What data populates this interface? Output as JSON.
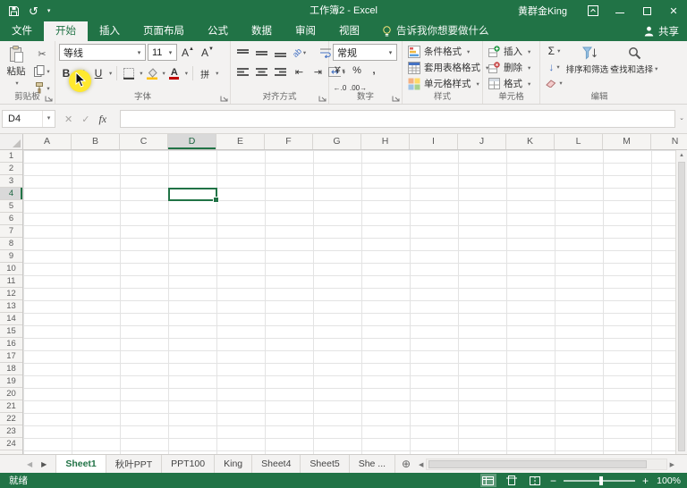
{
  "titlebar": {
    "title": "工作簿2 - Excel",
    "user": "黄群金King"
  },
  "ribbon_tabs": {
    "file": "文件",
    "items": [
      {
        "label": "开始",
        "active": true
      },
      {
        "label": "插入",
        "active": false
      },
      {
        "label": "页面布局",
        "active": false
      },
      {
        "label": "公式",
        "active": false
      },
      {
        "label": "数据",
        "active": false
      },
      {
        "label": "审阅",
        "active": false
      },
      {
        "label": "视图",
        "active": false
      }
    ],
    "tell_me": "告诉我你想要做什么",
    "share": "共享"
  },
  "ribbon": {
    "clipboard": {
      "group_label": "剪贴板",
      "paste_label": "粘贴"
    },
    "font": {
      "group_label": "字体",
      "font_name": "等线",
      "font_size": "11",
      "bold": "B",
      "italic": "I",
      "underline": "U",
      "phonetic": "拼"
    },
    "alignment": {
      "group_label": "对齐方式",
      "orientation": "ab"
    },
    "number": {
      "group_label": "数字",
      "format": "常规",
      "currency": "¥",
      "percent": "%",
      "comma": ",",
      "inc_decimal": "←.0",
      "dec_decimal": ".00→"
    },
    "styles": {
      "group_label": "样式",
      "conditional": "条件格式",
      "table": "套用表格格式",
      "cell_styles": "单元格样式"
    },
    "cells": {
      "group_label": "单元格",
      "insert": "插入",
      "delete": "删除",
      "format": "格式"
    },
    "editing": {
      "group_label": "编辑",
      "autosum": "Σ",
      "fill": "↓",
      "sort_filter": "排序和筛选",
      "find_select": "查找和选择"
    }
  },
  "formula_bar": {
    "name_box": "D4",
    "fx_label": "fx",
    "value": ""
  },
  "grid": {
    "columns": [
      "A",
      "B",
      "C",
      "D",
      "E",
      "F",
      "G",
      "H",
      "I",
      "J",
      "K",
      "L",
      "M",
      "N"
    ],
    "row_count": 24,
    "selected_cell": "D4",
    "selected_column": "D",
    "selected_row": 4
  },
  "sheets": {
    "tabs": [
      {
        "label": "Sheet1",
        "active": true
      },
      {
        "label": "秋叶PPT",
        "active": false
      },
      {
        "label": "PPT100",
        "active": false
      },
      {
        "label": "King",
        "active": false
      },
      {
        "label": "Sheet4",
        "active": false
      },
      {
        "label": "Sheet5",
        "active": false
      },
      {
        "label": "She ...",
        "active": false
      }
    ]
  },
  "status_bar": {
    "mode": "就绪",
    "zoom": "100%"
  },
  "colors": {
    "accent_green": "#217346",
    "font_color_red": "#c00000",
    "fill_yellow": "#ffc000",
    "click_highlight": "#ffe92e"
  }
}
